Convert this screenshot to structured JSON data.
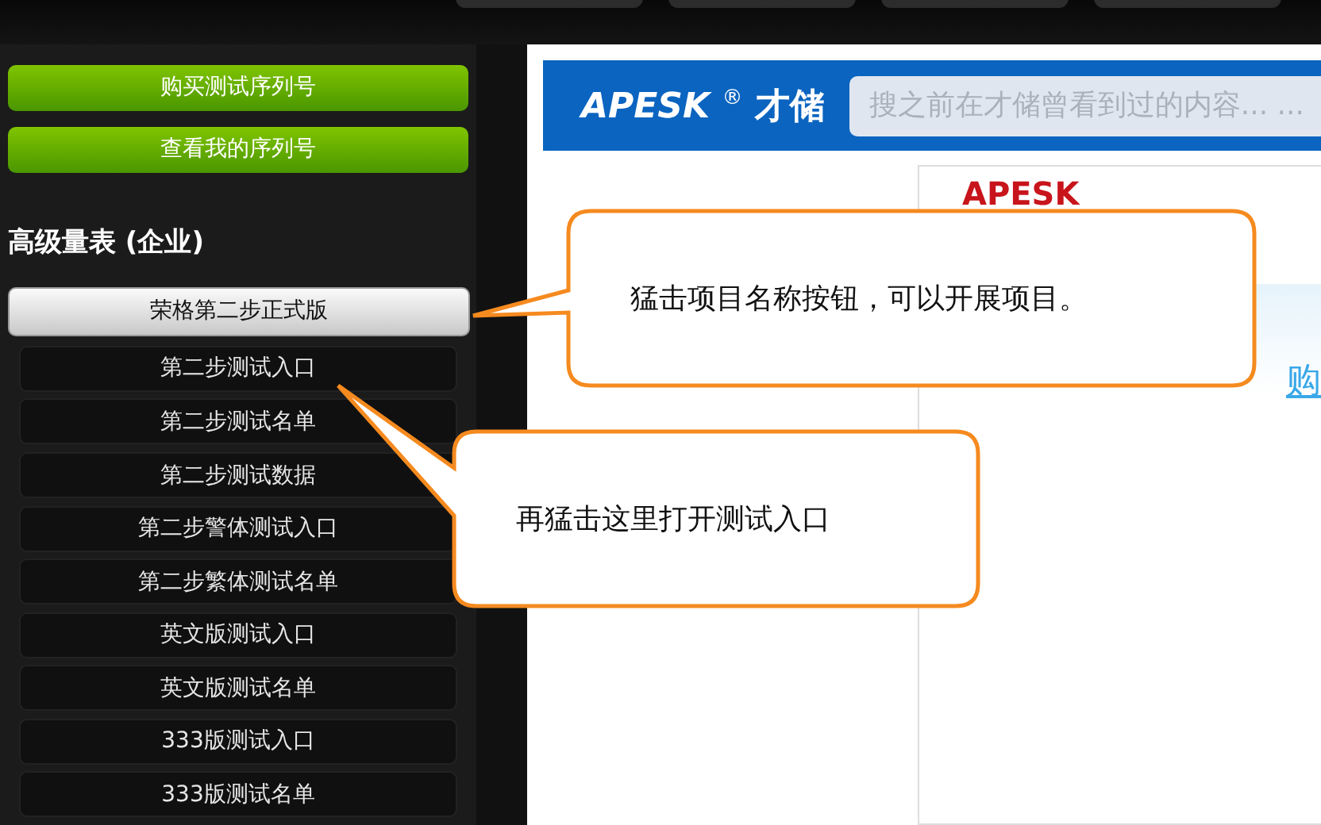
{
  "sidebar": {
    "buttons": [
      "购买测试序列号",
      "查看我的序列号"
    ],
    "section_title": "高级量表 (企业)",
    "project_button": "荣格第二步正式版",
    "items": [
      "第二步测试入口",
      "第二步测试名单",
      "第二步测试数据",
      "第二步警体测试入口",
      "第二步繁体测试名单",
      "英文版测试入口",
      "英文版测试名单",
      "333版测试入口",
      "333版测试名单"
    ]
  },
  "header": {
    "logo": "APESK",
    "logo_mark": "®",
    "logo_name": "才储",
    "search": {
      "placeholder": "搜之前在才储曾看到过的内容... ..."
    }
  },
  "content": {
    "brand": "APESK",
    "link": "购"
  },
  "callouts": [
    "猛击项目名称按钮，可以开展项目。",
    "再猛击这里打开测试入口"
  ]
}
